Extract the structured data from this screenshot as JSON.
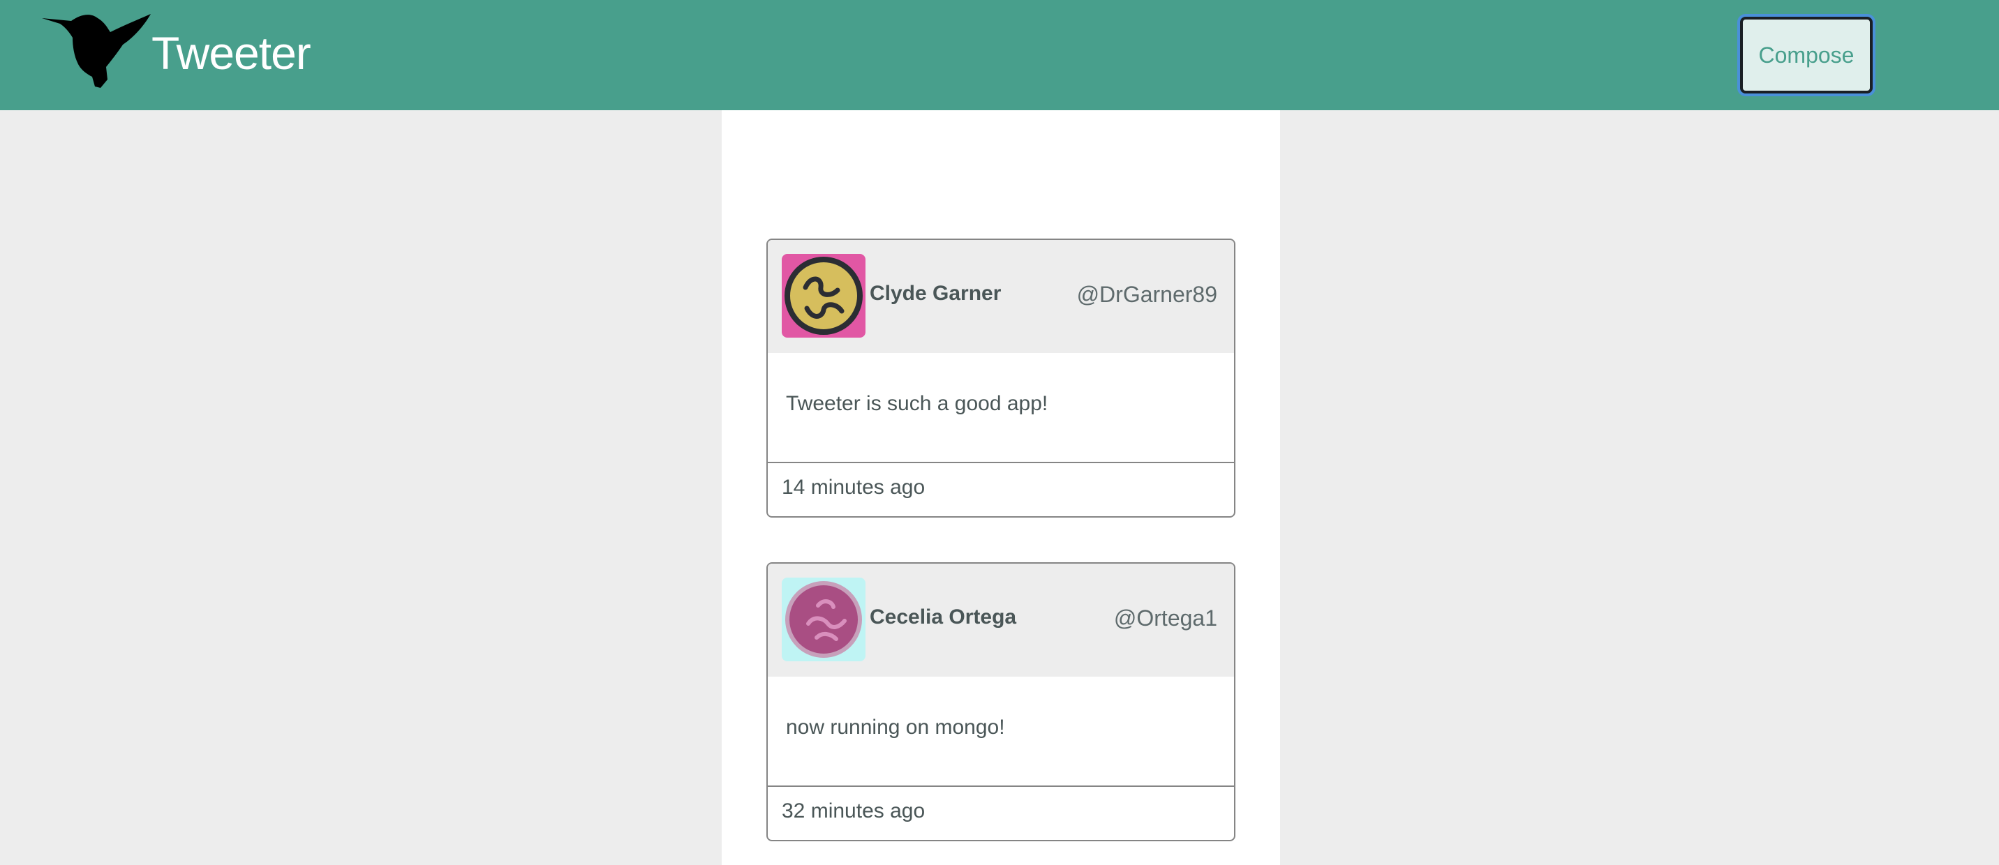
{
  "header": {
    "brand": "Tweeter",
    "compose_label": "Compose",
    "logo_icon": "hummingbird-icon",
    "color": "#489f8c"
  },
  "tweets": [
    {
      "name": "Clyde Garner",
      "handle": "@DrGarner89",
      "text": "Tweeter is such a good app!",
      "time": "14 minutes ago",
      "avatar_icon": "squiggle-face-avatar",
      "avatar_bg": "#e157a4",
      "avatar_fg": "#d6be5d"
    },
    {
      "name": "Cecelia Ortega",
      "handle": "@Ortega1",
      "text": "now running on mongo!",
      "time": "32 minutes ago",
      "avatar_icon": "squiggle-face-avatar",
      "avatar_bg": "#bff4f4",
      "avatar_fg": "#a94e83"
    }
  ]
}
